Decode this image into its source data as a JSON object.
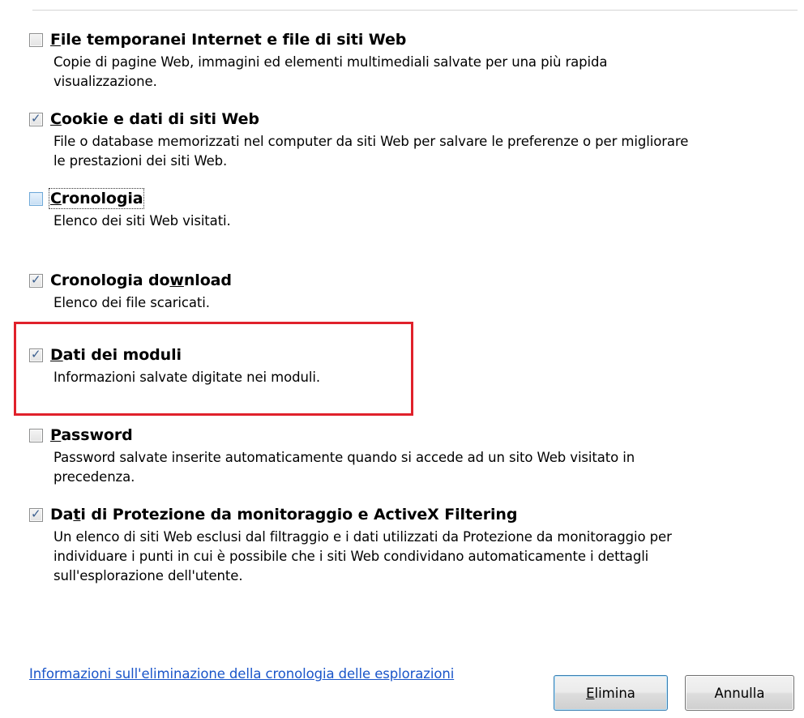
{
  "options": [
    {
      "id": "temp-files",
      "checked": false,
      "title_pre": "",
      "title_key": "F",
      "title_post": "ile temporanei Internet e file di siti Web",
      "description": "Copie di pagine Web, immagini ed elementi multimediali salvate per una più rapida\nvisualizzazione."
    },
    {
      "id": "cookies",
      "checked": true,
      "title_pre": "",
      "title_key": "C",
      "title_post": "ookie e dati di siti Web",
      "description": "File o database memorizzati nel computer da siti Web per salvare le preferenze o per migliorare\nle prestazioni dei siti Web."
    },
    {
      "id": "history",
      "checked": false,
      "focused": true,
      "title_pre": "",
      "title_key": "C",
      "title_post": "ronologia",
      "description": "Elenco dei siti Web visitati."
    },
    {
      "id": "download-history",
      "checked": true,
      "title_pre": "Cronologia do",
      "title_key": "w",
      "title_post": "nload",
      "description": "Elenco dei file scaricati."
    },
    {
      "id": "form-data",
      "checked": true,
      "title_pre": "",
      "title_key": "D",
      "title_post": "ati dei moduli",
      "description": "Informazioni salvate digitate nei moduli."
    },
    {
      "id": "passwords",
      "checked": false,
      "title_pre": "",
      "title_key": "P",
      "title_post": "assword",
      "description": "Password salvate inserite automaticamente quando si accede ad un sito Web visitato in\nprecedenza."
    },
    {
      "id": "tracking-protection",
      "checked": true,
      "title_pre": "Da",
      "title_key": "t",
      "title_post": "i di Protezione da monitoraggio e ActiveX Filtering",
      "description": "Un elenco di siti Web esclusi dal filtraggio e i dati utilizzati da Protezione da monitoraggio per\nindividuare i punti in cui è possibile che i siti Web condividano automaticamente i dettagli\nsull'esplorazione dell'utente."
    }
  ],
  "check_glyph": "✓",
  "help_link": "Informazioni sull'eliminazione della cronologia delle esplorazioni",
  "buttons": {
    "delete_key": "E",
    "delete_rest": "limina",
    "cancel": "Annulla"
  },
  "colors": {
    "highlight_border": "#e0212b",
    "link": "#1a55c9",
    "check": "#3b5f8f"
  }
}
